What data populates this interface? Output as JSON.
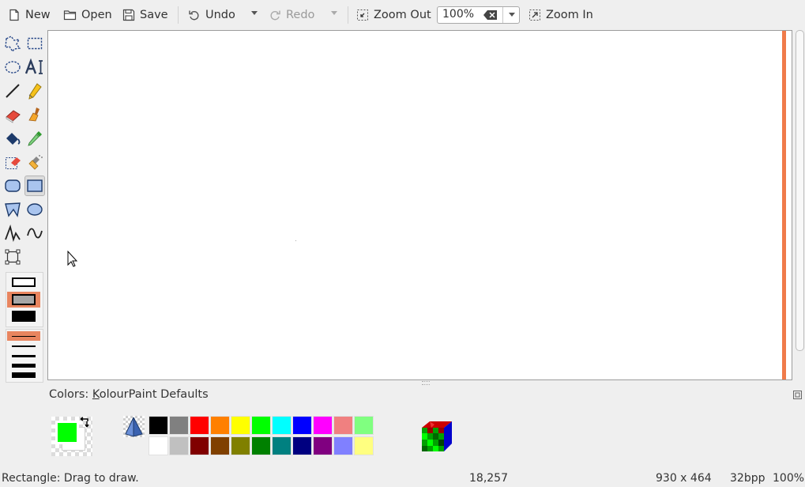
{
  "toolbar": {
    "new_label": "New",
    "open_label": "Open",
    "save_label": "Save",
    "undo_label": "Undo",
    "redo_label": "Redo",
    "zoom_out_label": "Zoom Out",
    "zoom_value": "100%",
    "zoom_in_label": "Zoom In"
  },
  "tools": {
    "selected": "rectangle",
    "fill_style_selected": "fill-with-background",
    "line_width_selected": 1
  },
  "colors": {
    "label_prefix": "Colors: ",
    "label_accel": "K",
    "label_rest": "olourPaint Defaults",
    "foreground": "#00ff00",
    "background": "#ffffff",
    "palette_top": [
      "#000000",
      "#808080",
      "#ff0000",
      "#ff8000",
      "#ffff00",
      "#00ff00",
      "#00ffff",
      "#0000ff",
      "#ff00ff",
      "#f08080",
      "#80ff80"
    ],
    "palette_bottom": [
      "#ffffff",
      "#c0c0c0",
      "#800000",
      "#804000",
      "#808000",
      "#008000",
      "#008080",
      "#000080",
      "#800080",
      "#8080ff",
      "#ffff80"
    ]
  },
  "status": {
    "message": "Rectangle: Drag to draw.",
    "cursor_pos": "18,257",
    "image_size": "930 x 464",
    "depth": "32bpp",
    "zoom": "100%"
  },
  "accent_color": "#e8855f"
}
